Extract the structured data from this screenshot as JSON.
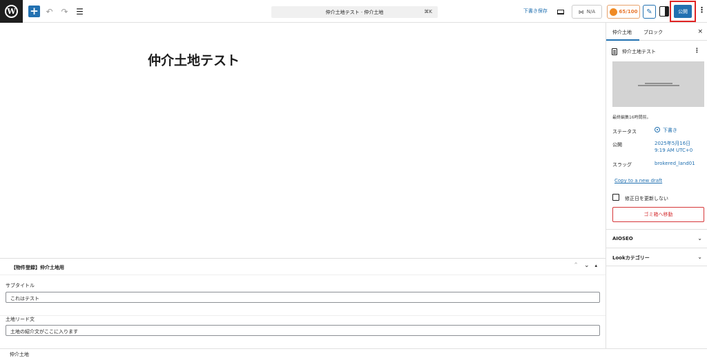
{
  "topbar": {
    "wp_logo": "W",
    "add_icon": "+",
    "undo_icon": "↶",
    "redo_icon": "↷",
    "list_view_icon": "☰",
    "command_title": "仲介土地テスト · 仲介土地",
    "command_shortcut": "⌘K",
    "save_draft_label": "下書き保存",
    "na_label": "N/A",
    "seo_score": "65/100",
    "magic_icon": "✎",
    "publish_label": "公開",
    "options_icon": "⋮"
  },
  "editor": {
    "post_title": "仲介土地テスト"
  },
  "metabox": {
    "title": "【物件登録】仲介土地用",
    "collapse_up_icon": "⌃",
    "move_down_icon": "⌄",
    "toggle_icon": "▴",
    "fields": [
      {
        "label": "サブタイトル",
        "value": "これはテスト"
      },
      {
        "label": "土地リード文",
        "value": "土地の紹介文がここに入ります"
      }
    ]
  },
  "footer": {
    "breadcrumb": "仲介土地"
  },
  "sidebar": {
    "tabs": [
      "仲介土地",
      "ブロック"
    ],
    "close_icon": "×",
    "summary_title": "仲介土地テスト",
    "summary_kebab": "⋮",
    "last_edited": "最終編集16時間前。",
    "rows": [
      {
        "label": "ステータス",
        "value": "下書き"
      },
      {
        "label": "公開",
        "value": "2025年5月16日\n9:19 AM UTC+0"
      },
      {
        "label": "スラッグ",
        "value": "brokered_land01"
      }
    ],
    "copy_draft": "Copy to a new draft",
    "checkbox_label": "修正日を更新しない",
    "trash_label": "ゴミ箱へ移動",
    "panels": [
      {
        "title": "AIOSEO",
        "chevron": "⌄"
      },
      {
        "title": "Lookカテゴリー",
        "chevron": "⌄"
      }
    ]
  },
  "colors": {
    "accent": "#2271b1",
    "highlight": "#e02424",
    "danger": "#d63638",
    "seo": "#f08a24"
  }
}
